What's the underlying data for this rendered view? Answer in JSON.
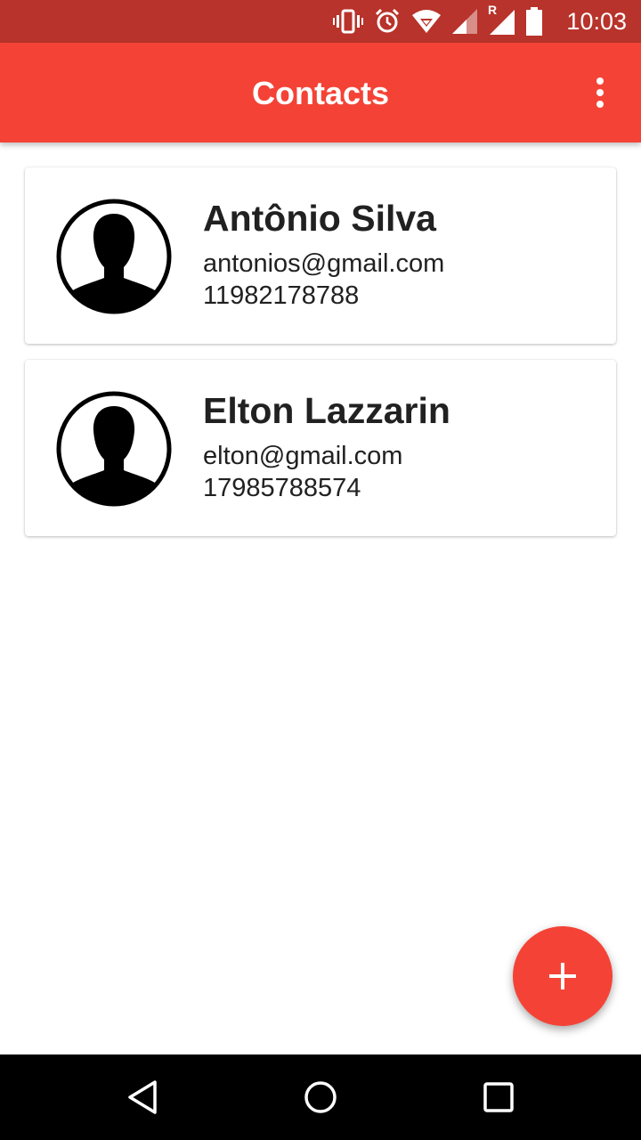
{
  "status_bar": {
    "time": "10:03",
    "icons": [
      "vibrate-icon",
      "alarm-icon",
      "wifi-icon",
      "signal-icon",
      "roaming-signal-icon",
      "battery-icon"
    ],
    "roaming_label": "R",
    "background": "#b8332b"
  },
  "app_bar": {
    "title": "Contacts",
    "menu_icon": "more-vert-icon",
    "background": "#f44336"
  },
  "contacts": [
    {
      "name": "Antônio Silva",
      "email": "antonios@gmail.com",
      "phone": "11982178788",
      "avatar_icon": "person-avatar-icon"
    },
    {
      "name": "Elton Lazzarin",
      "email": "elton@gmail.com",
      "phone": "17985788574",
      "avatar_icon": "person-avatar-icon"
    }
  ],
  "fab": {
    "icon": "plus-icon",
    "color": "#f44336"
  },
  "nav_bar": {
    "icons": [
      "back-icon",
      "home-icon",
      "recents-icon"
    ]
  }
}
